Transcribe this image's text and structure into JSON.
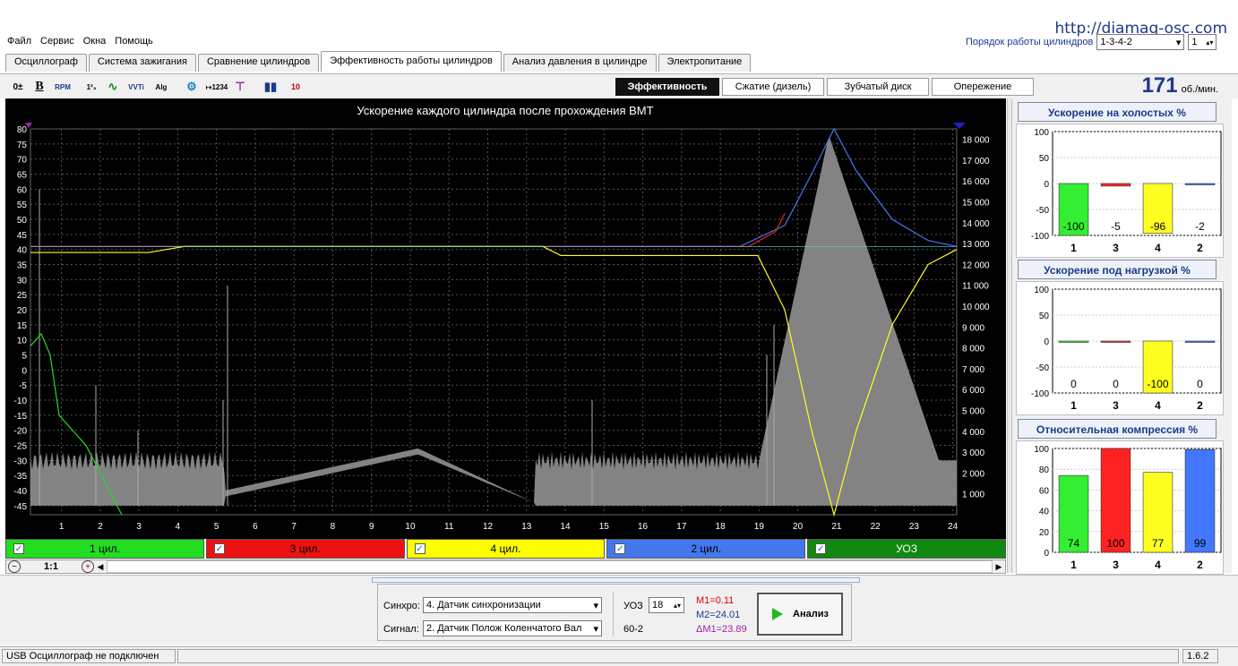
{
  "header": {
    "url": "http://diamag-osc.com",
    "menu": [
      "Файл",
      "Сервис",
      "Окна",
      "Помощь"
    ],
    "order_label": "Порядок работы цилиндров",
    "order_value": "1-3-4-2",
    "order_index": "1"
  },
  "tabs": [
    "Осциллограф",
    "Система зажигания",
    "Сравнение цилиндров",
    "Эффективность работы цилиндров",
    "Анализ давления в цилиндре",
    "Электропитание"
  ],
  "active_tab": 3,
  "subtabs": [
    "Эффективность",
    "Сжатие (дизель)",
    "Зубчатый диск",
    "Опережение"
  ],
  "rpm": {
    "value": "171",
    "unit": "об./мин."
  },
  "main_chart": {
    "title": "Ускорение каждого цилиндра после прохождения ВМТ",
    "left_ticks": [
      "80",
      "75",
      "70",
      "65",
      "60",
      "55",
      "50",
      "45",
      "40",
      "35",
      "30",
      "25",
      "20",
      "15",
      "10",
      "5",
      "0",
      "-5",
      "-10",
      "-15",
      "-20",
      "-25",
      "-30",
      "-35",
      "-40",
      "-45"
    ],
    "right_ticks": [
      "18 000",
      "17 000",
      "16 000",
      "15 000",
      "14 000",
      "13 000",
      "12 000",
      "11 000",
      "10 000",
      "9 000",
      "8 000",
      "7 000",
      "6 000",
      "5 000",
      "4 000",
      "3 000",
      "2 000",
      "1 000"
    ],
    "x_ticks": [
      "1",
      "2",
      "3",
      "4",
      "5",
      "6",
      "7",
      "8",
      "9",
      "10",
      "11",
      "12",
      "13",
      "14",
      "15",
      "16",
      "17",
      "18",
      "19",
      "20",
      "21",
      "22",
      "23",
      "24"
    ]
  },
  "legend": [
    {
      "label": "1 цил.",
      "color": "#22dd22",
      "text": "#000"
    },
    {
      "label": "3 цил.",
      "color": "#ee1111",
      "text": "#000"
    },
    {
      "label": "4 цил.",
      "color": "#ffff00",
      "text": "#000"
    },
    {
      "label": "2 цил.",
      "color": "#4477ee",
      "text": "#000"
    },
    {
      "label": "УОЗ",
      "color": "#118811",
      "text": "#000"
    }
  ],
  "zoom": "1:1",
  "controls": {
    "sync_label": "Синхро:",
    "sync_value": "4.  Датчик синхронизации",
    "signal_label": "Сигнал:",
    "signal_value": "2.  Датчик Полож Коленчатого Вал",
    "uoz_label": "УОЗ",
    "uoz_value": "18",
    "teeth": "60-2",
    "m1": "M1=0.11",
    "m2": "M2=24.01",
    "dm1": "ΔM1=23.89",
    "analyze_label": "Анализ"
  },
  "status": {
    "left": "USB Осциллограф не подключен",
    "version": "1.6.2"
  },
  "right_charts": [
    {
      "title": "Ускорение на холостых %",
      "ticks": [
        "100",
        "50",
        "0",
        "-50",
        "-100"
      ],
      "cats": [
        "1",
        "3",
        "4",
        "2"
      ],
      "values": [
        -100,
        -5,
        -96,
        -2
      ],
      "labels": [
        "-100",
        "-5",
        "-96",
        "-2"
      ],
      "min": -100,
      "max": 100
    },
    {
      "title": "Ускорение под нагрузкой %",
      "ticks": [
        "100",
        "50",
        "0",
        "-50",
        "-100"
      ],
      "cats": [
        "1",
        "3",
        "4",
        "2"
      ],
      "values": [
        0,
        0,
        -100,
        0
      ],
      "labels": [
        "0",
        "0",
        "-100",
        "0"
      ],
      "min": -100,
      "max": 100
    },
    {
      "title": "Относительная компрессия %",
      "ticks": [
        "100",
        "80",
        "60",
        "40",
        "20",
        "0"
      ],
      "cats": [
        "1",
        "3",
        "4",
        "2"
      ],
      "values": [
        74,
        100,
        77,
        99
      ],
      "labels": [
        "74",
        "100",
        "77",
        "99"
      ],
      "min": 0,
      "max": 100
    }
  ],
  "bar_colors": [
    "#33ee33",
    "#ff2222",
    "#ffff22",
    "#4477ff"
  ]
}
